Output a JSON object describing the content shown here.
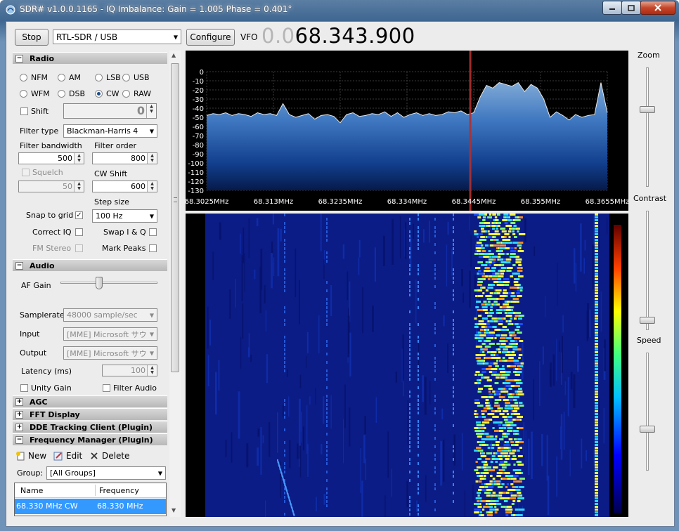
{
  "window": {
    "title": "SDR# v1.0.0.1165 - IQ Imbalance: Gain = 1.005 Phase = 0.401°"
  },
  "toolbar": {
    "stop_label": "Stop",
    "device": "RTL-SDR / USB",
    "configure_label": "Configure",
    "vfo_label": "VFO",
    "vfo_dim": "0.0",
    "vfo_value": "68.343.900"
  },
  "radio": {
    "header": "Radio",
    "modes": [
      "NFM",
      "AM",
      "LSB",
      "USB",
      "WFM",
      "DSB",
      "CW",
      "RAW"
    ],
    "selected_mode": "CW",
    "shift_label": "Shift",
    "shift_value": "0",
    "filter_type_label": "Filter type",
    "filter_type": "Blackman-Harris 4",
    "filter_bandwidth_label": "Filter bandwidth",
    "filter_bandwidth": "500",
    "filter_order_label": "Filter order",
    "filter_order": "800",
    "squelch_label": "Squelch",
    "squelch_value": "50",
    "cw_shift_label": "CW Shift",
    "cw_shift": "600",
    "step_size_label": "Step size",
    "snap_label": "Snap to grid",
    "snap_checked": true,
    "step_size": "100 Hz",
    "correct_iq_label": "Correct IQ",
    "swap_iq_label": "Swap I & Q",
    "fm_stereo_label": "FM Stereo",
    "mark_peaks_label": "Mark Peaks"
  },
  "audio": {
    "header": "Audio",
    "af_gain_label": "AF Gain",
    "af_gain_level": 0.4,
    "samplerate_label": "Samplerate",
    "samplerate": "48000 sample/sec",
    "input_label": "Input",
    "input": "[MME] Microsoft サウ",
    "output_label": "Output",
    "output": "[MME] Microsoft サウ",
    "latency_label": "Latency (ms)",
    "latency": "100",
    "unity_gain_label": "Unity Gain",
    "filter_audio_label": "Filter Audio"
  },
  "collapsed_sections": [
    "AGC",
    "FFT Display",
    "DDE Tracking Client (Plugin)"
  ],
  "freq_manager": {
    "header": "Frequency Manager (Plugin)",
    "new_label": "New",
    "edit_label": "Edit",
    "delete_label": "Delete",
    "group_label": "Group:",
    "group_value": "[All Groups]",
    "columns": [
      "Name",
      "Frequency"
    ],
    "rows": [
      [
        "68.330 MHz CW",
        "68.330 MHz"
      ]
    ]
  },
  "side_controls": {
    "zoom_label": "Zoom",
    "contrast_label": "Contrast",
    "speed_label": "Speed",
    "zoom_level": 0.35,
    "contrast_level": 0.08,
    "speed_level": 0.35
  },
  "chart_data": {
    "type": "area",
    "ylabel": "",
    "xlabel": "",
    "y_ticks": [
      "0",
      "-10",
      "-20",
      "-30",
      "-40",
      "-50",
      "-60",
      "-70",
      "-80",
      "-90",
      "-100",
      "-110",
      "-120",
      "-130"
    ],
    "x_ticks": [
      "68.3025MHz",
      "68.313MHz",
      "68.3235MHz",
      "68.334MHz",
      "68.3445MHz",
      "68.355MHz",
      "68.3655MHz"
    ],
    "ylim": [
      -130,
      0
    ],
    "xlim": [
      68.3025,
      68.3655
    ],
    "vfo_marker": 68.3439,
    "x": [
      68.3025,
      68.3035,
      68.3045,
      68.3055,
      68.3065,
      68.3075,
      68.3085,
      68.3095,
      68.3105,
      68.3115,
      68.3125,
      68.3135,
      68.3145,
      68.3155,
      68.3165,
      68.3175,
      68.3185,
      68.3195,
      68.3205,
      68.3215,
      68.3225,
      68.3235,
      68.3245,
      68.3255,
      68.3265,
      68.3275,
      68.3285,
      68.3295,
      68.3305,
      68.3315,
      68.3325,
      68.3335,
      68.3345,
      68.3355,
      68.3365,
      68.3375,
      68.3385,
      68.3395,
      68.3405,
      68.3415,
      68.3425,
      68.3435,
      68.3445,
      68.3455,
      68.3465,
      68.3475,
      68.3485,
      68.3495,
      68.3505,
      68.3515,
      68.3525,
      68.3535,
      68.3545,
      68.3555,
      68.3565,
      68.3575,
      68.3585,
      68.3595,
      68.3605,
      68.3615,
      68.3625,
      68.3635,
      68.3645,
      68.3655
    ],
    "values": [
      -48,
      -46,
      -47,
      -45,
      -48,
      -46,
      -47,
      -49,
      -45,
      -47,
      -46,
      -48,
      -35,
      -47,
      -50,
      -48,
      -46,
      -52,
      -48,
      -47,
      -49,
      -56,
      -47,
      -45,
      -49,
      -48,
      -46,
      -47,
      -44,
      -49,
      -45,
      -50,
      -47,
      -45,
      -48,
      -46,
      -48,
      -47,
      -44,
      -45,
      -43,
      -47,
      -45,
      -28,
      -15,
      -18,
      -12,
      -14,
      -16,
      -12,
      -22,
      -14,
      -18,
      -30,
      -50,
      -44,
      -48,
      -53,
      -47,
      -50,
      -48,
      -47,
      -12,
      -45
    ]
  }
}
